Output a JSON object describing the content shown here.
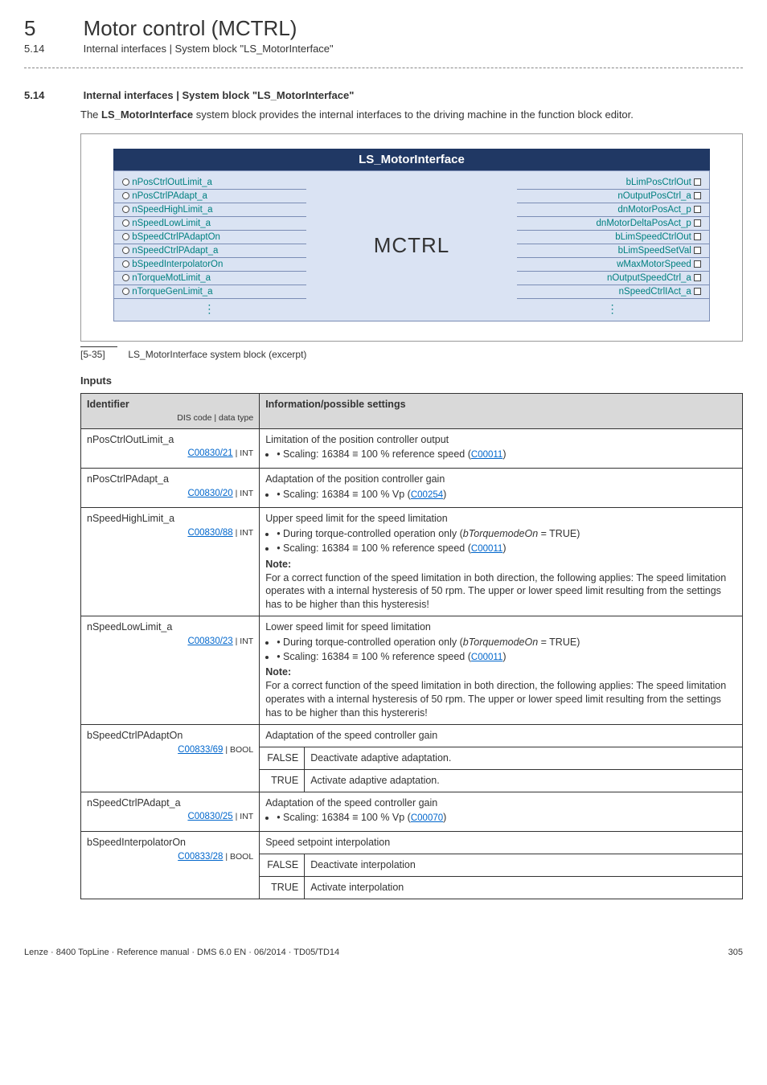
{
  "chapter": {
    "num": "5",
    "title": "Motor control (MCTRL)"
  },
  "sub": {
    "num": "5.14",
    "title": "Internal interfaces | System block \"LS_MotorInterface\""
  },
  "section": {
    "num": "5.14",
    "title": "Internal interfaces | System block \"LS_MotorInterface\""
  },
  "intro": {
    "pre": "The ",
    "bold": "LS_MotorInterface",
    "post": " system block provides the internal interfaces to the driving machine in the function block editor."
  },
  "diagram": {
    "title": "LS_MotorInterface",
    "mid": "MCTRL",
    "left": [
      "nPosCtrlOutLimit_a",
      "nPosCtrlPAdapt_a",
      "nSpeedHighLimit_a",
      "nSpeedLowLimit_a",
      "bSpeedCtrlPAdaptOn",
      "nSpeedCtrlPAdapt_a",
      "bSpeedInterpolatorOn",
      "nTorqueMotLimit_a",
      "nTorqueGenLimit_a"
    ],
    "right": [
      "bLimPosCtrlOut",
      "nOutputPosCtrl_a",
      "dnMotorPosAct_p",
      "dnMotorDeltaPosAct_p",
      "bLimSpeedCtrlOut",
      "bLimSpeedSetVal",
      "wMaxMotorSpeed",
      "nOutputSpeedCtrl_a",
      "nSpeedCtrlIAct_a"
    ]
  },
  "caption": {
    "tag": "[5-35]",
    "text": "LS_MotorInterface system block (excerpt)"
  },
  "inputs_heading": "Inputs",
  "th": {
    "id": "Identifier",
    "dis": "DIS code | data type",
    "info": "Information/possible settings"
  },
  "rows": [
    {
      "id": "nPosCtrlOutLimit_a",
      "code": "C00830/21",
      "dtype": "INT",
      "desc": "Limitation of the position controller output",
      "bullets": [
        "Scaling: 16384 ≡ 100 % reference speed (C00011)"
      ]
    },
    {
      "id": "nPosCtrlPAdapt_a",
      "code": "C00830/20",
      "dtype": "INT",
      "desc": "Adaptation of the position controller gain",
      "bullets": [
        "Scaling: 16384 ≡ 100 % Vp (C00254)"
      ]
    },
    {
      "id": "nSpeedHighLimit_a",
      "code": "C00830/88",
      "dtype": "INT",
      "desc": "Upper speed limit for the speed limitation",
      "bullets": [
        "During torque-controlled operation only (bTorquemodeOn = TRUE)",
        "Scaling: 16384 ≡ 100 % reference speed (C00011)"
      ],
      "note": "Note:",
      "notetext": "For a correct function of the speed limitation in both direction, the following applies: The speed limitation operates with a internal hysteresis of 50 rpm. The upper or lower speed limit resulting from the settings has to be higher than this hysteresis!"
    },
    {
      "id": "nSpeedLowLimit_a",
      "code": "C00830/23",
      "dtype": "INT",
      "desc": "Lower speed limit for speed limitation",
      "bullets": [
        "During torque-controlled operation only (bTorquemodeOn = TRUE)",
        "Scaling: 16384 ≡ 100 % reference speed (C00011)"
      ],
      "note": "Note:",
      "notetext": "For a correct function of the speed limitation in both direction, the following applies: The speed limitation operates with a internal hysteresis of 50 rpm. The upper or lower speed limit resulting from the settings has to be higher than this hystereris!"
    },
    {
      "id": "bSpeedCtrlPAdaptOn",
      "code": "C00833/69",
      "dtype": "BOOL",
      "desc": "Adaptation of the speed controller gain",
      "opts": [
        [
          "FALSE",
          "Deactivate adaptive adaptation."
        ],
        [
          "TRUE",
          "Activate adaptive adaptation."
        ]
      ]
    },
    {
      "id": "nSpeedCtrlPAdapt_a",
      "code": "C00830/25",
      "dtype": "INT",
      "desc": "Adaptation of the speed controller gain",
      "bullets": [
        "Scaling: 16384 ≡ 100 % Vp (C00070)"
      ]
    },
    {
      "id": "bSpeedInterpolatorOn",
      "code": "C00833/28",
      "dtype": "BOOL",
      "desc": "Speed setpoint interpolation",
      "opts": [
        [
          "FALSE",
          "Deactivate interpolation"
        ],
        [
          "TRUE",
          "Activate interpolation"
        ]
      ]
    }
  ],
  "footer": {
    "left": "Lenze · 8400 TopLine · Reference manual · DMS 6.0 EN · 06/2014 · TD05/TD14",
    "right": "305"
  }
}
